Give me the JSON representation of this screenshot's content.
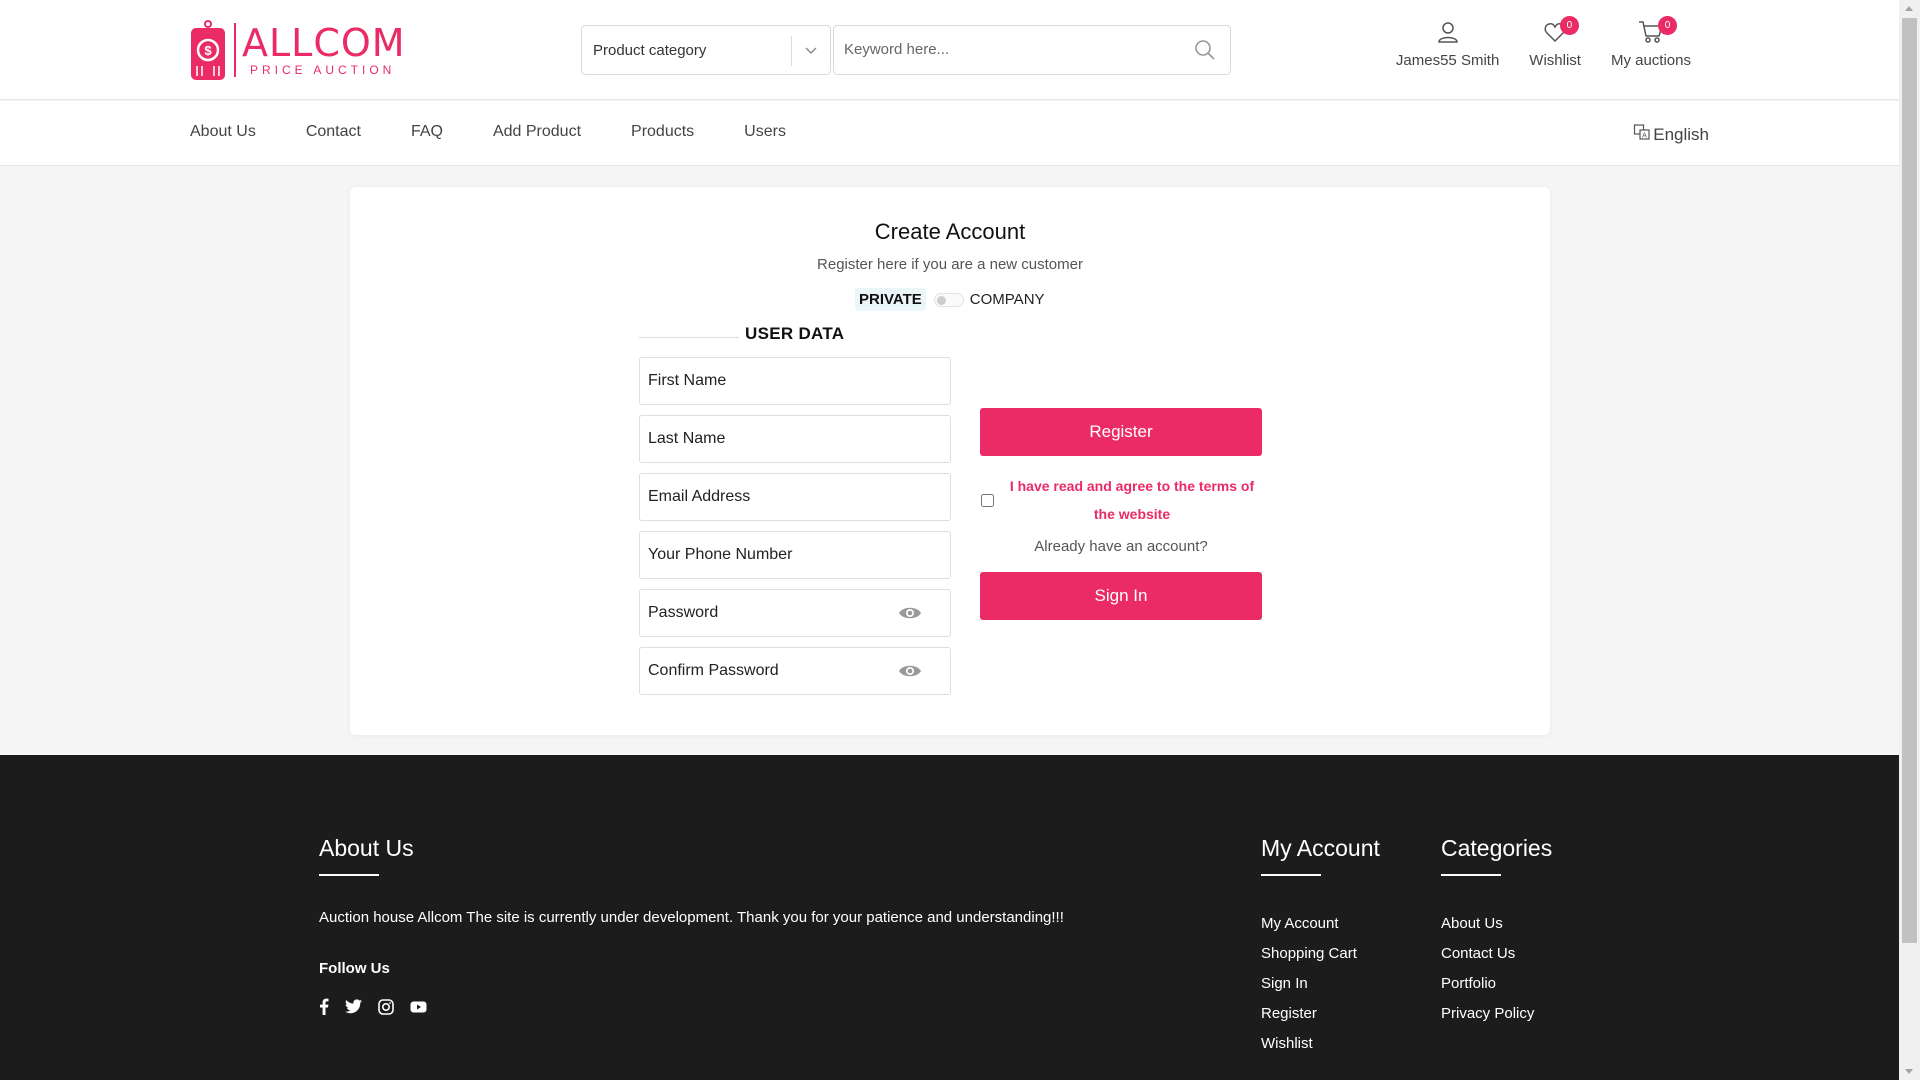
{
  "brand": {
    "name": "ALLCOM",
    "tagline": "PRICE AUCTION",
    "accent": "#ea2b66"
  },
  "search": {
    "category_label": "Product category",
    "keyword_placeholder": "Keyword here..."
  },
  "header_actions": {
    "user_name": "James55 Smith",
    "wishlist_label": "Wishlist",
    "wishlist_count": "0",
    "auctions_label": "My auctions",
    "auctions_count": "0"
  },
  "nav": {
    "items": [
      "About Us",
      "Contact",
      "FAQ",
      "Add Product",
      "Products",
      "Users"
    ],
    "language": "English"
  },
  "register": {
    "title": "Create Account",
    "subtitle": "Register here if you are a new customer",
    "toggle_private": "PRIVATE",
    "toggle_company": "COMPANY",
    "section_title": "USER DATA",
    "fields": {
      "first_name": "First Name",
      "last_name": "Last Name",
      "email": "Email Address",
      "phone": "Your Phone Number",
      "password": "Password",
      "confirm_password": "Confirm Password"
    },
    "register_button": "Register",
    "terms_label": "I have read and agree to the terms of the website",
    "already_text": "Already have an account?",
    "signin_button": "Sign In"
  },
  "footer": {
    "about_title": "About Us",
    "about_text": "Auction house Allcom The site is currently under development. Thank you for your patience and understanding!!!",
    "follow_title": "Follow Us",
    "socials": [
      "facebook-icon",
      "twitter-icon",
      "instagram-icon",
      "youtube-icon"
    ],
    "account_title": "My Account",
    "account_links": [
      "My Account",
      "Shopping Cart",
      "Sign In",
      "Register",
      "Wishlist"
    ],
    "categories_title": "Categories",
    "categories_links": [
      "About Us",
      "Contact Us",
      "Portfolio",
      "Privacy Policy"
    ]
  }
}
